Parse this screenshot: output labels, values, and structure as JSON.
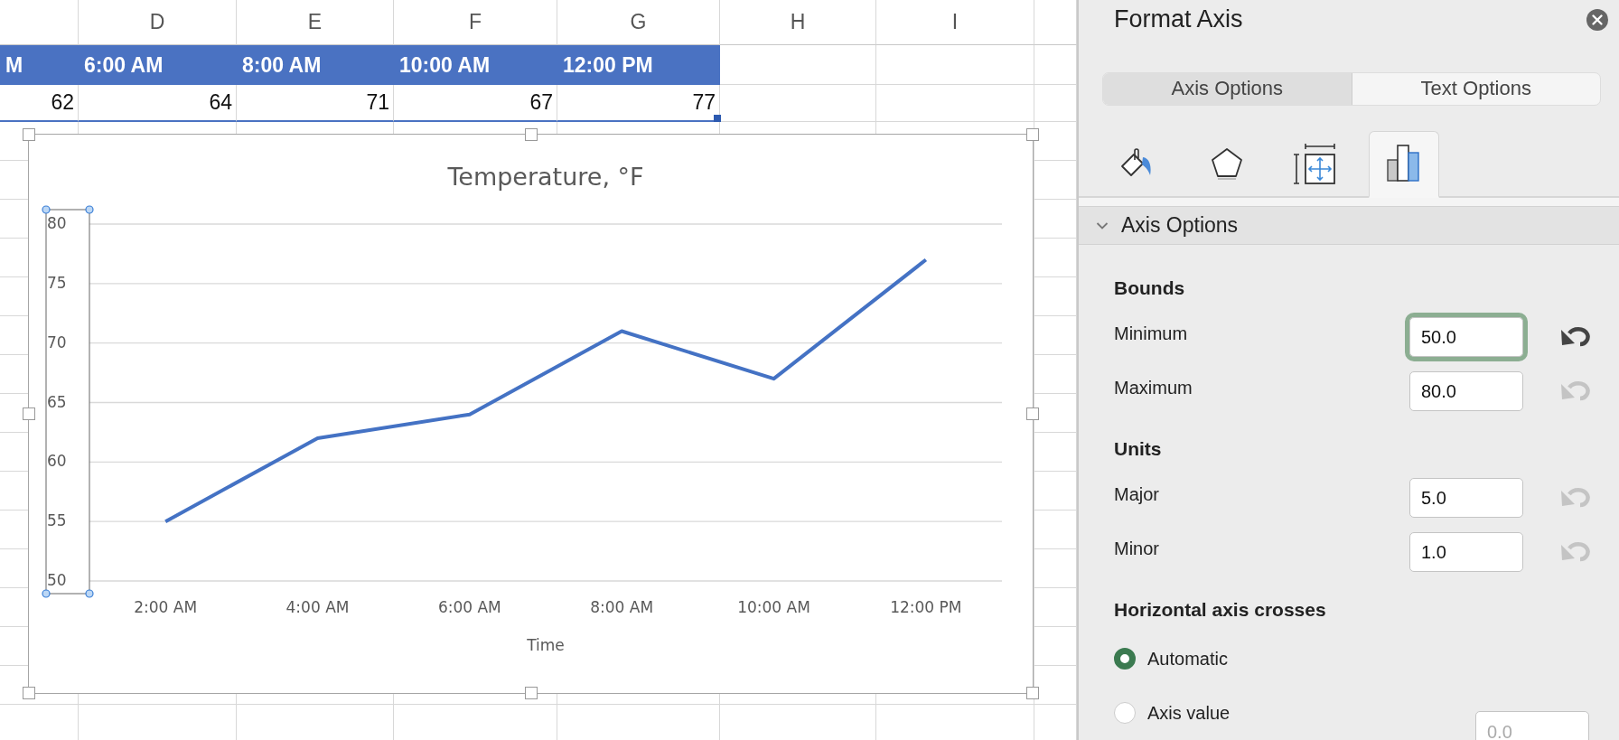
{
  "sheet": {
    "columns": [
      "D",
      "E",
      "F",
      "G",
      "H",
      "I"
    ],
    "header_row": [
      "M",
      "6:00 AM",
      "8:00 AM",
      "10:00 AM",
      "12:00 PM"
    ],
    "value_row": [
      "62",
      "64",
      "71",
      "67",
      "77"
    ]
  },
  "chart": {
    "selected": true,
    "axis_selected": true,
    "chart_data": {
      "type": "line",
      "title": "Temperature, °F",
      "xlabel": "Time",
      "categories": [
        "2:00 AM",
        "4:00 AM",
        "6:00 AM",
        "8:00 AM",
        "10:00 AM",
        "12:00 PM"
      ],
      "series": [
        {
          "color": "#4472c4",
          "values": [
            55,
            62,
            64,
            71,
            67,
            77
          ]
        }
      ],
      "ylim": [
        50,
        80
      ],
      "yticks": [
        50,
        55,
        60,
        65,
        70,
        75,
        80
      ],
      "grid": true
    }
  },
  "panel": {
    "title": "Format Axis",
    "tabs": [
      {
        "label": "Axis Options",
        "selected": true
      },
      {
        "label": "Text Options",
        "selected": false
      }
    ],
    "icon_tabs": [
      {
        "kind": "fill",
        "selected": false
      },
      {
        "kind": "effects",
        "selected": false
      },
      {
        "kind": "size",
        "selected": false
      },
      {
        "kind": "options",
        "selected": true
      }
    ],
    "section": {
      "label": "Axis Options",
      "expanded": true
    },
    "groups": [
      {
        "heading": "Bounds",
        "rows": [
          {
            "label": "Minimum",
            "value": "50.0",
            "focused": true,
            "reset_enabled": true
          },
          {
            "label": "Maximum",
            "value": "80.0",
            "focused": false,
            "reset_enabled": false
          }
        ]
      },
      {
        "heading": "Units",
        "rows": [
          {
            "label": "Major",
            "value": "5.0",
            "focused": false,
            "reset_enabled": false
          },
          {
            "label": "Minor",
            "value": "1.0",
            "focused": false,
            "reset_enabled": false
          }
        ]
      }
    ],
    "crosses": {
      "heading": "Horizontal axis crosses",
      "options": [
        {
          "label": "Automatic",
          "selected": true
        },
        {
          "label": "Axis value",
          "selected": false,
          "placeholder": "0.0"
        }
      ]
    }
  }
}
